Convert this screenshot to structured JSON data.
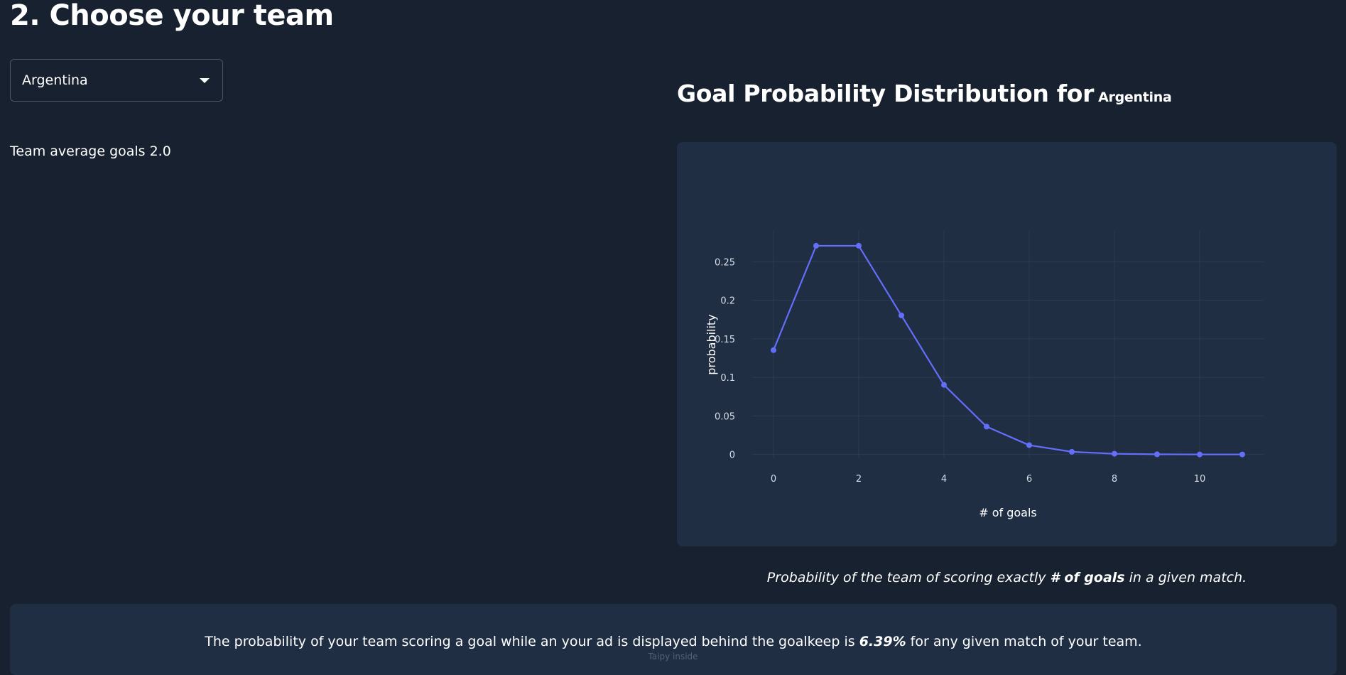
{
  "page": {
    "title": "2. Choose your team"
  },
  "team_select": {
    "value": "Argentina"
  },
  "team_average": {
    "label": "Team average goals",
    "value": "2.0"
  },
  "chart_heading": {
    "prefix": "Goal Probability Distribution for",
    "team": "Argentina"
  },
  "chart_data": {
    "type": "line",
    "xlabel": "# of goals",
    "ylabel": "probability",
    "x": [
      0,
      1,
      2,
      3,
      4,
      5,
      6,
      7,
      8,
      9,
      10,
      11
    ],
    "y": [
      0.1353,
      0.2707,
      0.2707,
      0.1804,
      0.0902,
      0.0361,
      0.012,
      0.0034,
      0.0009,
      0.0002,
      0.0,
      0.0
    ],
    "xticks": [
      0,
      2,
      4,
      6,
      8,
      10
    ],
    "yticks": [
      0,
      0.05,
      0.1,
      0.15,
      0.2,
      0.25
    ],
    "xlim": [
      -0.5,
      11.5
    ],
    "ylim": [
      -0.005,
      0.29
    ],
    "line_color": "#636efa",
    "grid": true
  },
  "caption": {
    "before": "Probability of the team of scoring exactly",
    "bold": "# of goals",
    "after": "in a given match."
  },
  "result": {
    "before": "The probability of your team scoring a goal while an your ad is displayed behind the goalkeep is",
    "value": "6.39%",
    "after": "for any given match of your team."
  },
  "footer": {
    "text": "Taipy inside"
  }
}
